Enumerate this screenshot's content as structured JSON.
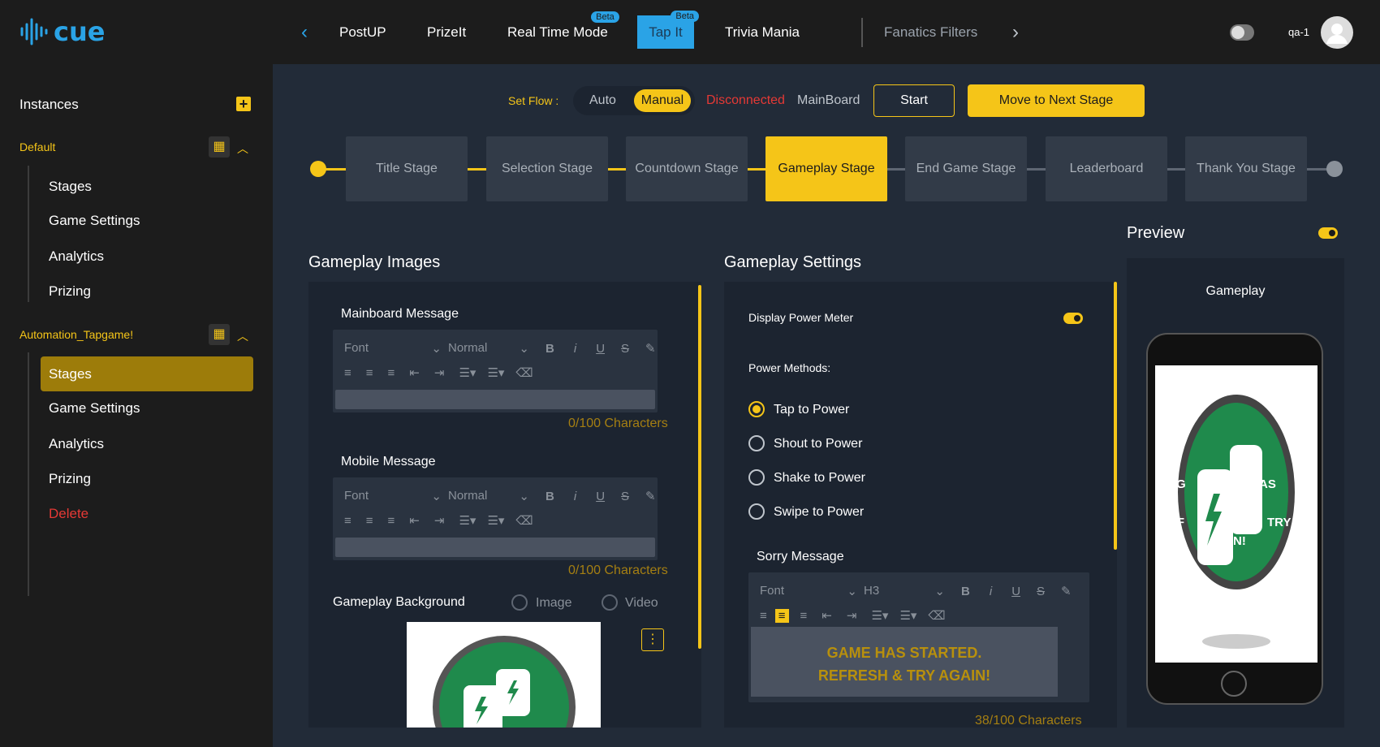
{
  "header": {
    "logo_text": "cue",
    "nav": [
      "PostUP",
      "PrizeIt",
      "Real Time Mode",
      "Tap It",
      "Trivia Mania",
      "Fanatics Filters"
    ],
    "beta_label": "Beta",
    "user": "qa-1"
  },
  "sidebar": {
    "title": "Instances",
    "groups": [
      {
        "name": "Default",
        "items": [
          "Stages",
          "Game Settings",
          "Analytics",
          "Prizing"
        ]
      },
      {
        "name": "Automation_Tapgame!",
        "items": [
          "Stages",
          "Game Settings",
          "Analytics",
          "Prizing",
          "Delete"
        ]
      }
    ]
  },
  "flow": {
    "label": "Set Flow :",
    "auto": "Auto",
    "manual": "Manual",
    "status": "Disconnected",
    "board": "MainBoard",
    "start": "Start",
    "next": "Move to Next Stage"
  },
  "stages": [
    "Title Stage",
    "Selection Stage",
    "Countdown Stage",
    "Gameplay Stage",
    "End Game Stage",
    "Leaderboard",
    "Thank You Stage"
  ],
  "active_stage_index": 3,
  "images": {
    "title": "Gameplay Images",
    "mainboard_label": "Mainboard Message",
    "mobile_label": "Mobile Message",
    "font": "Font",
    "normal": "Normal",
    "count": "0/100 Characters",
    "bg_label": "Gameplay Background",
    "opt_image": "Image",
    "opt_video": "Video"
  },
  "settings": {
    "title": "Gameplay Settings",
    "power_meter": "Display Power Meter",
    "methods_label": "Power Methods:",
    "methods": [
      "Tap to Power",
      "Shout to Power",
      "Shake to Power",
      "Swipe to Power"
    ],
    "selected_method": 0,
    "sorry_label": "Sorry Message",
    "font": "Font",
    "heading": "H3",
    "sorry_line1": "GAME HAS STARTED.",
    "sorry_line2": "REFRESH & TRY AGAIN!",
    "sorry_count": "38/100 Characters"
  },
  "preview": {
    "title": "Preview",
    "screen_title": "Gameplay",
    "overlay_lines": [
      "G",
      "AS",
      "REF",
      "TRY",
      "N!"
    ]
  },
  "colors": {
    "accent": "#f5c518",
    "blue": "#2aa3e6",
    "danger": "#e53935",
    "bg": "#222b38"
  }
}
